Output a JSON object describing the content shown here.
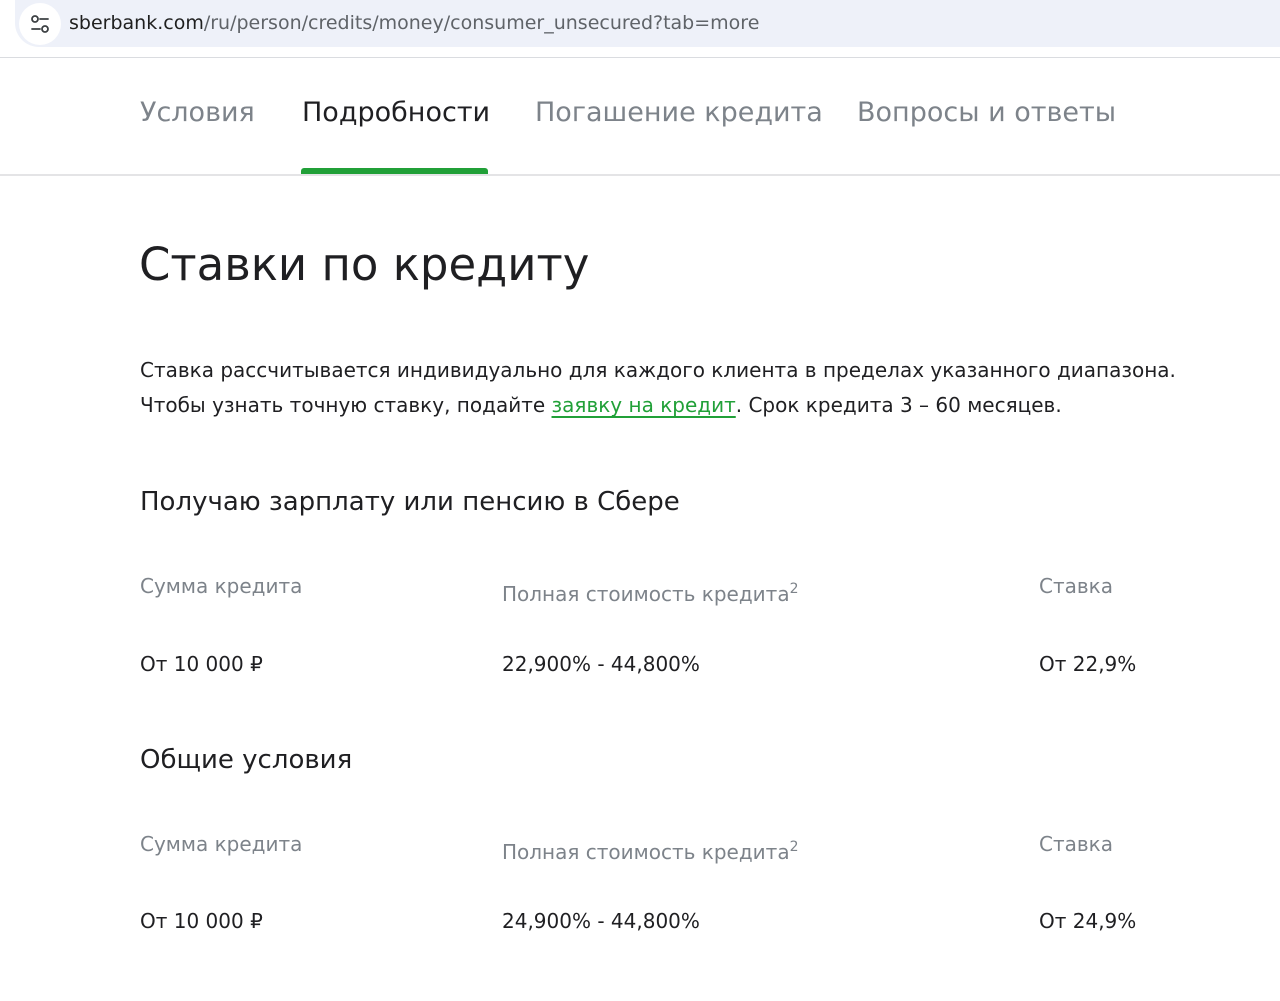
{
  "browser": {
    "url_host": "sberbank.com",
    "url_path": "/ru/person/credits/money/consumer_unsecured?tab=more",
    "site_info_icon": "tune-icon"
  },
  "tabs": [
    {
      "label": "Условия",
      "active": false
    },
    {
      "label": "Подробности",
      "active": true
    },
    {
      "label": "Погашение кредита",
      "active": false
    },
    {
      "label": "Вопросы и ответы",
      "active": false
    }
  ],
  "accent_color": "#21a038",
  "page_title": "Ставки по кредиту",
  "intro": {
    "line1": "Ставка рассчитывается индивидуально для каждого клиента в пределах указанного диапазона.",
    "line2_before": "Чтобы узнать точную ставку, подайте ",
    "link": "заявку на кредит",
    "line2_after": ". Срок кредита 3 – 60 месяцев."
  },
  "sections": [
    {
      "title": "Получаю зарплату или пенсию в Сбере",
      "headers": {
        "amount": "Сумма кредита",
        "full_cost": "Полная стоимость кредита",
        "full_cost_note": "2",
        "rate": "Ставка"
      },
      "row": {
        "amount": "От 10 000 ₽",
        "full_cost": "22,900% - 44,800%",
        "rate": "От 22,9%"
      }
    },
    {
      "title": "Общие условия",
      "headers": {
        "amount": "Сумма кредита",
        "full_cost": "Полная стоимость кредита",
        "full_cost_note": "2",
        "rate": "Ставка"
      },
      "row": {
        "amount": "От 10 000 ₽",
        "full_cost": "24,900% - 44,800%",
        "rate": "От 24,9%"
      }
    }
  ]
}
